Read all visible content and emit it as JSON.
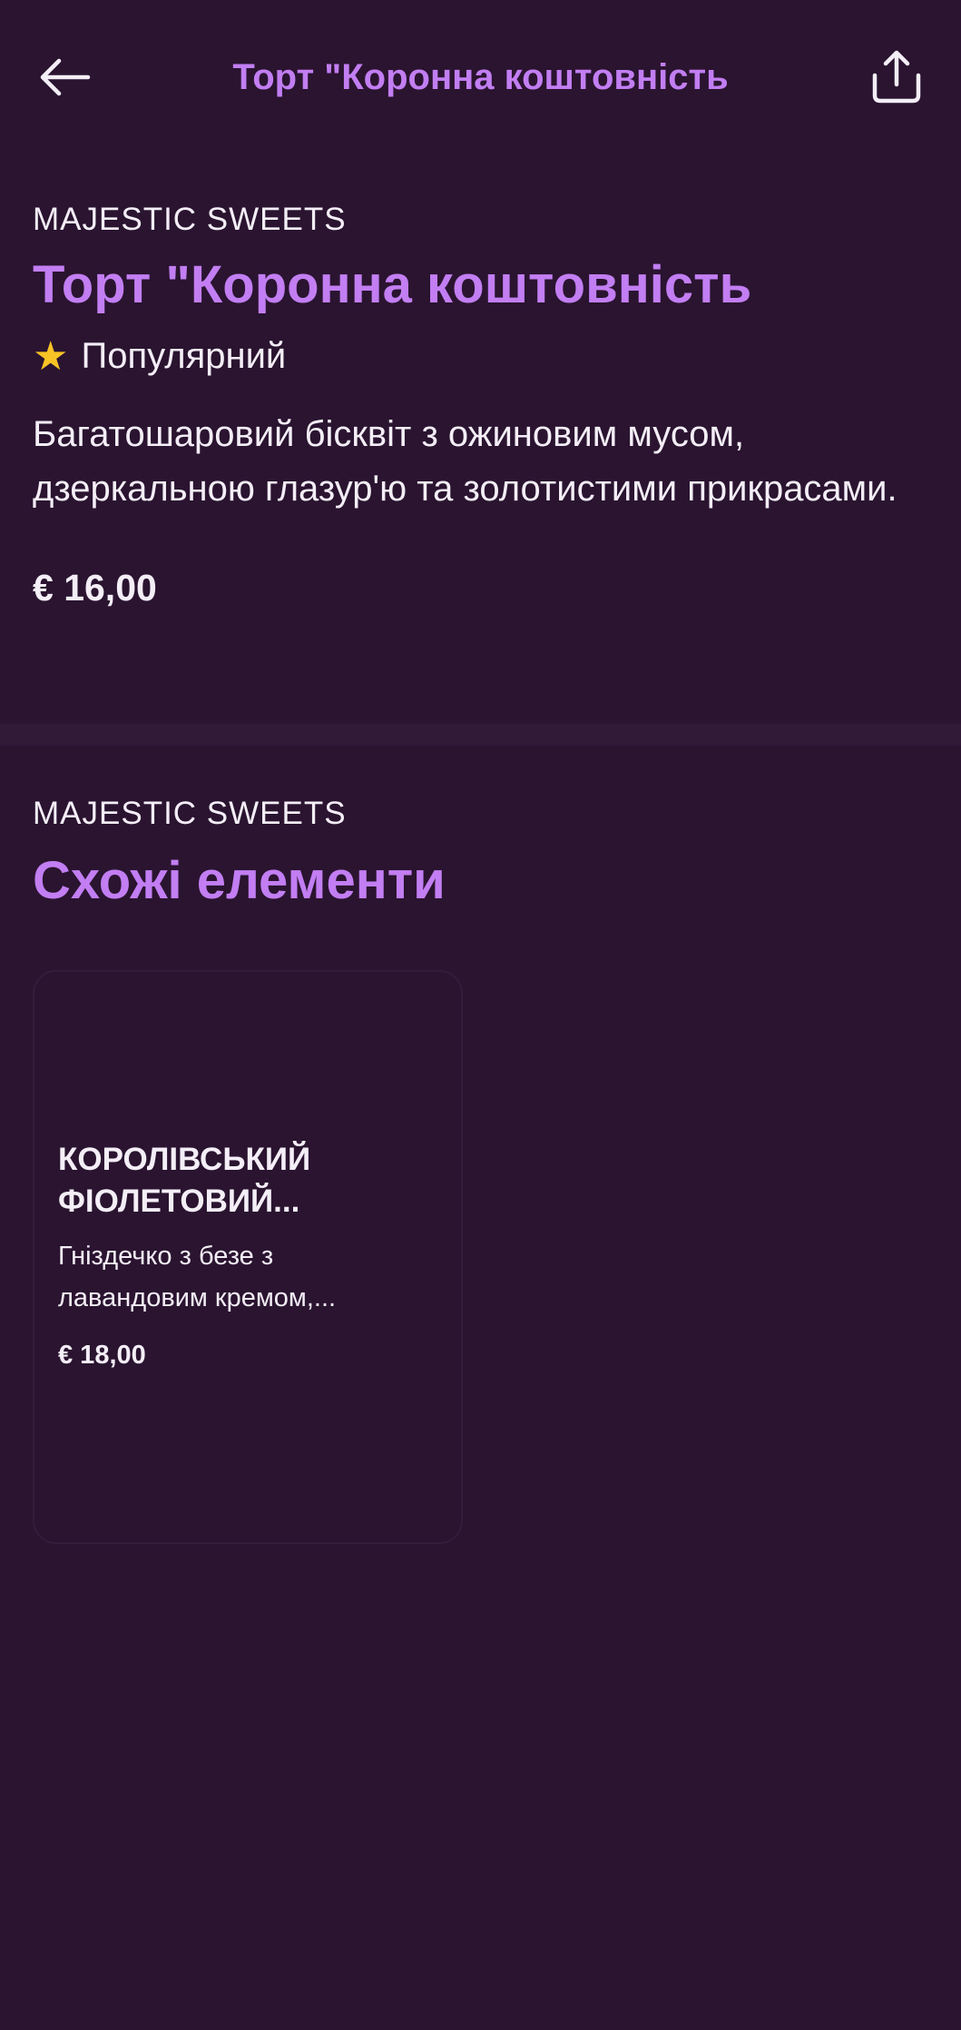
{
  "header": {
    "title": "Торт \"Коронна коштовність",
    "back_icon": "arrow-left-icon",
    "share_icon": "share-icon"
  },
  "product": {
    "store": "MAJESTIC SWEETS",
    "title": "Торт \"Коронна коштовність",
    "badge": "Популярний",
    "badge_icon": "star-icon",
    "description": "Багатошаровий бісквіт з ожиновим мусом, дзеркальною глазур'ю та золотистими прикрасами.",
    "price": "€ 16,00"
  },
  "similar": {
    "store": "MAJESTIC SWEETS",
    "heading": "Схожі елементи",
    "items": [
      {
        "title_line1": "КОРОЛІВСЬКИЙ",
        "title_line2": "ФІОЛЕТОВИЙ...",
        "desc_line1": "Гніздечко з безе з",
        "desc_line2": "лавандовим кремом,...",
        "price": "€ 18,00"
      }
    ]
  },
  "colors": {
    "background": "#2a1430",
    "accent": "#c27ef2",
    "star": "#f7c325",
    "text": "#f4eef7"
  }
}
